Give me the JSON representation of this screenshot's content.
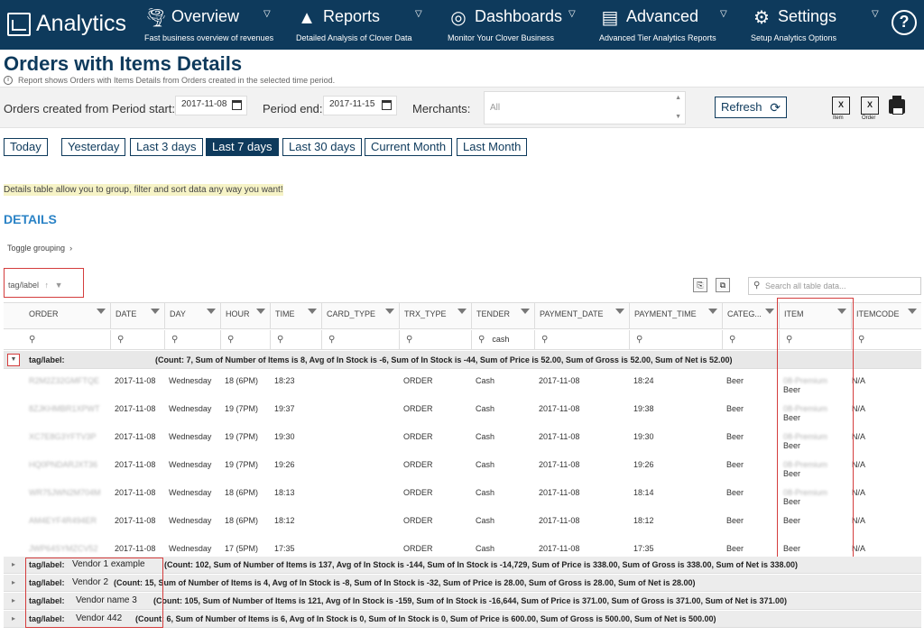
{
  "nav": {
    "brand": "Analytics",
    "items": [
      {
        "title": "Overview",
        "sub": "Fast business overview of revenues"
      },
      {
        "title": "Reports",
        "sub": "Detailed Analysis of Clover Data"
      },
      {
        "title": "Dashboards",
        "sub": "Monitor Your Clover Business"
      },
      {
        "title": "Advanced",
        "sub": "Advanced Tier Analytics Reports"
      },
      {
        "title": "Settings",
        "sub": "Setup Analytics Options"
      }
    ],
    "help": "?"
  },
  "page": {
    "title": "Orders with Items Details",
    "description": "Report shows Orders with Items Details from Orders created in the selected time period."
  },
  "filters": {
    "period_start_label": "Orders created from Period start:",
    "period_start": "2017-11-08",
    "period_end_label": "Period end:",
    "period_end": "2017-11-15",
    "merchants_label": "Merchants:",
    "merchants_value": "All",
    "refresh": "Refresh",
    "export_item": "Item",
    "export_order": "Order"
  },
  "periods": [
    "Today",
    "Yesterday",
    "Last 3 days",
    "Last 7 days",
    "Last 30 days",
    "Current Month",
    "Last Month"
  ],
  "active_period": "Last 7 days",
  "hint": "Details table allow you to group, filter and sort data any way you want!",
  "details": {
    "title": "DETAILS",
    "toggle_grouping": "Toggle grouping",
    "group_chip": "tag/label",
    "search_placeholder": "Search all table data..."
  },
  "table": {
    "columns": [
      "ORDER",
      "DATE",
      "DAY",
      "HOUR",
      "TIME",
      "CARD_TYPE",
      "TRX_TYPE",
      "TENDER",
      "PAYMENT_DATE",
      "PAYMENT_TIME",
      "CATEG...",
      "ITEM",
      "ITEMCODE"
    ],
    "tender_filter": "cash",
    "group": {
      "label": "tag/label:",
      "summary": "(Count: 7, Sum of Number of Items is 8, Avg of In Stock is -6, Sum of In Stock is -44, Sum of Price is 52.00, Sum of Gross is 52.00, Sum of Net is 52.00)"
    },
    "rows": [
      {
        "order": "R2M2Z32GMFTQE",
        "date": "2017-11-08",
        "day": "Wednesday",
        "hour": "18 (6PM)",
        "time": "18:23",
        "trx": "ORDER",
        "tender": "Cash",
        "pdate": "2017-11-08",
        "ptime": "18:24",
        "cat": "Beer",
        "item_blur": "08-Premium",
        "item": "Beer",
        "code": "N/A"
      },
      {
        "order": "8ZJKHMBR1XPWT",
        "date": "2017-11-08",
        "day": "Wednesday",
        "hour": "19 (7PM)",
        "time": "19:37",
        "trx": "ORDER",
        "tender": "Cash",
        "pdate": "2017-11-08",
        "ptime": "19:38",
        "cat": "Beer",
        "item_blur": "08-Premium",
        "item": "Beer",
        "code": "N/A"
      },
      {
        "order": "XC7E8G3YFTV3P",
        "date": "2017-11-08",
        "day": "Wednesday",
        "hour": "19 (7PM)",
        "time": "19:30",
        "trx": "ORDER",
        "tender": "Cash",
        "pdate": "2017-11-08",
        "ptime": "19:30",
        "cat": "Beer",
        "item_blur": "08-Premium",
        "item": "Beer",
        "code": "N/A"
      },
      {
        "order": "HQ0PNDARJXT36",
        "date": "2017-11-08",
        "day": "Wednesday",
        "hour": "19 (7PM)",
        "time": "19:26",
        "trx": "ORDER",
        "tender": "Cash",
        "pdate": "2017-11-08",
        "ptime": "19:26",
        "cat": "Beer",
        "item_blur": "08-Premium",
        "item": "Beer",
        "code": "N/A"
      },
      {
        "order": "WR75JWN2M704M",
        "date": "2017-11-08",
        "day": "Wednesday",
        "hour": "18 (6PM)",
        "time": "18:13",
        "trx": "ORDER",
        "tender": "Cash",
        "pdate": "2017-11-08",
        "ptime": "18:14",
        "cat": "Beer",
        "item_blur": "08-Premium",
        "item": "Beer",
        "code": "N/A"
      },
      {
        "order": "AM4EYF4R494ER",
        "date": "2017-11-08",
        "day": "Wednesday",
        "hour": "18 (6PM)",
        "time": "18:12",
        "trx": "ORDER",
        "tender": "Cash",
        "pdate": "2017-11-08",
        "ptime": "18:12",
        "cat": "Beer",
        "item_blur": "",
        "item": "Beer",
        "code": "N/A"
      },
      {
        "order": "JWP64SYMZCV52",
        "date": "2017-11-08",
        "day": "Wednesday",
        "hour": "17 (5PM)",
        "time": "17:35",
        "trx": "ORDER",
        "tender": "Cash",
        "pdate": "2017-11-08",
        "ptime": "17:35",
        "cat": "Beer",
        "item_blur": "",
        "item": "Beer",
        "code": "N/A"
      }
    ],
    "other_groups": [
      {
        "label": "tag/label:",
        "vendor": "Vendor 1  example",
        "summary": "(Count: 102, Sum of Number of Items is 137, Avg of In Stock is -144, Sum of In Stock is -14,729, Sum of Price is 338.00, Sum of Gross is 338.00, Sum of Net is 338.00)"
      },
      {
        "label": "tag/label:",
        "vendor": "Vendor 2",
        "summary": "(Count: 15, Sum of Number of Items is 4, Avg of In Stock is -8, Sum of In Stock is -32, Sum of Price is 28.00, Sum of Gross is 28.00, Sum of Net is 28.00)"
      },
      {
        "label": "tag/label:",
        "vendor": "Vendor name 3",
        "summary": "(Count: 105, Sum of Number of Items is 121, Avg of In Stock is -159, Sum of In Stock is -16,644, Sum of Price is 371.00, Sum of Gross is 371.00, Sum of Net is 371.00)"
      },
      {
        "label": "tag/label:",
        "vendor": "Vendor 442",
        "summary": "(Count: 6, Sum of Number of Items is 6, Avg of In Stock is 0, Sum of In Stock is 0, Sum of Price is 600.00, Sum of Gross is 500.00, Sum of Net is 500.00)"
      }
    ]
  },
  "colors": {
    "nav_bg": "#0e3a5c",
    "accent": "#2b83c6",
    "highlight": "#d43d3d"
  }
}
